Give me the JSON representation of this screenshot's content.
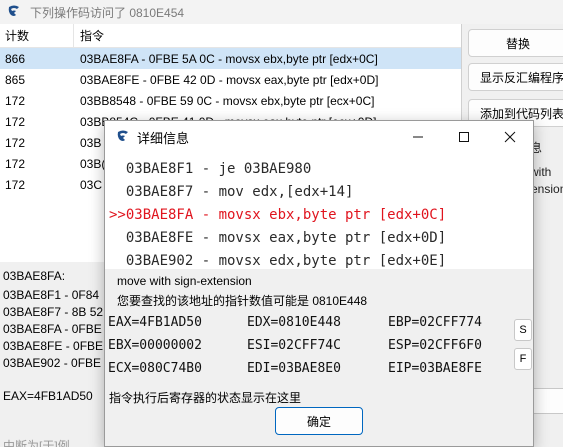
{
  "main_window": {
    "title": "下列操作码访问了 0810E454",
    "columns": {
      "count": "计数",
      "instruction": "指令"
    },
    "rows": [
      {
        "count": "866",
        "instruction": "03BAE8FA - 0FBE 5A 0C  - movsx ebx,byte ptr [edx+0C]",
        "selected": true
      },
      {
        "count": "865",
        "instruction": "03BAE8FE - 0FBE 42 0D  - movsx eax,byte ptr [edx+0D]",
        "selected": false
      },
      {
        "count": "172",
        "instruction": "03BB8548 - 0FBE 59 0C  - movsx ebx,byte ptr [ecx+0C]",
        "selected": false
      },
      {
        "count": "172",
        "instruction": "03BB854C - 0FBE 41 0D  - movsx eax,byte ptr [ecx+0D]",
        "selected": false
      },
      {
        "count": "172",
        "instruction": "03B",
        "selected": false
      },
      {
        "count": "172",
        "instruction": "03B(",
        "selected": false
      },
      {
        "count": "172",
        "instruction": "03C",
        "selected": false
      }
    ],
    "buttons": {
      "replace": "替换",
      "show_disassembler": "显示反汇编程序",
      "add_to_codelist": "添加到代码列表",
      "detail_fragment": "息",
      "with_fragment": "with",
      "extension_fragment": "ension"
    },
    "lower_pane": {
      "address_label": "03BAE8FA:",
      "lines": [
        "03BAE8F1 - 0F84",
        "03BAE8F7 - 8B 52",
        "03BAE8FA - 0FBE",
        "03BAE8FE - 0FBE",
        "03BAE902 - 0FBE"
      ],
      "eax": "EAX=4FB1AD50",
      "bottom_fragment": "中断为[于]例..."
    }
  },
  "dialog": {
    "title": "详细信息",
    "code_lines": [
      {
        "text": "  03BAE8F1 - je 03BAE980",
        "current": false
      },
      {
        "text": "  03BAE8F7 - mov edx,[edx+14]",
        "current": false
      },
      {
        "text": ">>03BAE8FA - movsx ebx,byte ptr [edx+0C]",
        "current": true
      },
      {
        "text": "  03BAE8FE - movsx eax,byte ptr [edx+0D]",
        "current": false
      },
      {
        "text": "  03BAE902 - movsx edx,byte ptr [edx+0E]",
        "current": false
      }
    ],
    "instruction_desc": "move with sign-extension",
    "pointer_hint": "您要查找的该地址的指针数值可能是 0810E448",
    "registers": [
      [
        "EAX=4FB1AD50",
        "EDX=0810E448",
        "EBP=02CFF774"
      ],
      [
        "EBX=00000002",
        "ESI=02CFF74C",
        "ESP=02CFF6F0"
      ],
      [
        "ECX=080C74B0",
        "EDI=03BAE8E0",
        "EIP=03BAE8FE"
      ]
    ],
    "s_button": "S",
    "f_button": "F",
    "status_hint": "指令执行后寄存器的状态显示在这里",
    "ok_button": "确定"
  },
  "colors": {
    "current_line": "#e0141e",
    "selection": "#cfe4f7",
    "ok_border": "#0067c0"
  }
}
